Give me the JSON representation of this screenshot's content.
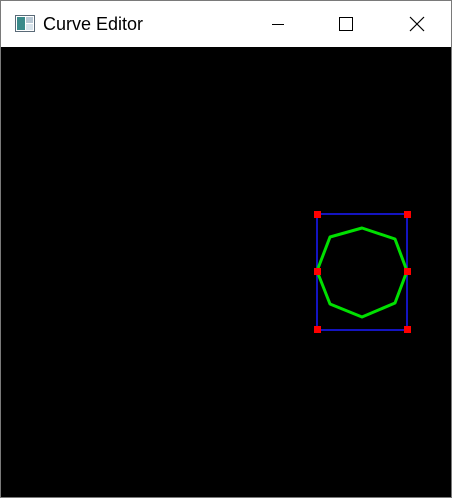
{
  "window": {
    "title": "Curve Editor"
  },
  "titlebar_buttons": {
    "minimize_icon": "minimize-icon",
    "maximize_icon": "maximize-icon",
    "close_icon": "close-icon"
  },
  "colors": {
    "canvas_background": "#000000",
    "curve": "#00e000",
    "bounding_box": "#1a1aff",
    "control_point": "#ff0000"
  }
}
